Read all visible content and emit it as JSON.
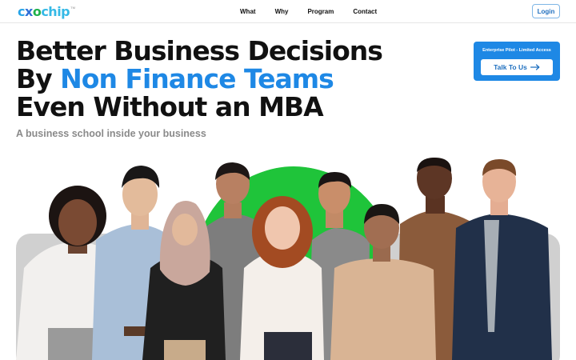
{
  "brand": {
    "logo_parts": [
      "c",
      "x",
      "o",
      "chip"
    ],
    "trademark": "TM"
  },
  "nav": {
    "items": [
      {
        "label": "What"
      },
      {
        "label": "Why"
      },
      {
        "label": "Program"
      },
      {
        "label": "Contact"
      }
    ],
    "login_label": "Login"
  },
  "hero": {
    "headline_line1": "Better Business Decisions",
    "headline_line2_prefix": "By ",
    "headline_line2_accent": "Non Finance Teams",
    "headline_line3": "Even Without an MBA",
    "subhead": "A business school inside your business"
  },
  "cta": {
    "label": "Enterprise Pilot - Limited Access",
    "button_label": "Talk To Us",
    "button_icon": "arrow-right-icon"
  },
  "colors": {
    "accent": "#1e88e5",
    "green_arc": "#1fc43a",
    "backdrop_gray": "#cfcfcf"
  }
}
